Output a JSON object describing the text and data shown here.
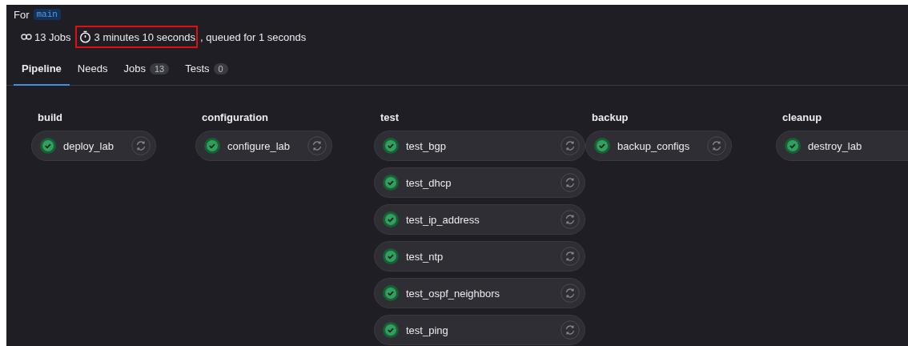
{
  "header": {
    "for_label": "For",
    "ref": "main",
    "jobs_count": "13 Jobs",
    "duration": "3 minutes 10 seconds",
    "queued": ", queued for 1 seconds"
  },
  "tabs": [
    {
      "label": "Pipeline",
      "selected": true
    },
    {
      "label": "Needs",
      "selected": false
    },
    {
      "label": "Jobs",
      "count": "13",
      "selected": false
    },
    {
      "label": "Tests",
      "count": "0",
      "selected": false
    }
  ],
  "stages": [
    {
      "name": "build",
      "jobs": [
        {
          "name": "deploy_lab",
          "kind": "success"
        }
      ]
    },
    {
      "name": "configuration",
      "jobs": [
        {
          "name": "configure_lab",
          "kind": "success"
        }
      ]
    },
    {
      "name": "test",
      "jobs": [
        {
          "name": "test_bgp",
          "kind": "success"
        },
        {
          "name": "test_dhcp",
          "kind": "success"
        },
        {
          "name": "test_ip_address",
          "kind": "success"
        },
        {
          "name": "test_ntp",
          "kind": "success"
        },
        {
          "name": "test_ospf_neighbors",
          "kind": "success"
        },
        {
          "name": "test_ping",
          "kind": "success"
        }
      ]
    },
    {
      "name": "backup",
      "jobs": [
        {
          "name": "backup_configs",
          "kind": "success"
        }
      ]
    },
    {
      "name": "cleanup",
      "jobs": [
        {
          "name": "destroy_lab",
          "kind": "success"
        }
      ]
    }
  ]
}
